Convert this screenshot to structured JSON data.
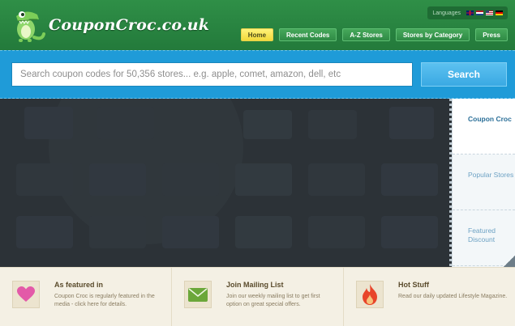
{
  "header": {
    "logo_text": "CouponCroc.co.uk",
    "languages_label": "Languages",
    "flags": [
      "uk-flag-icon",
      "nl-flag-icon",
      "us-flag-icon",
      "de-flag-icon"
    ]
  },
  "nav": {
    "items": [
      {
        "label": "Home",
        "active": true
      },
      {
        "label": "Recent Codes"
      },
      {
        "label": "A-Z Stores"
      },
      {
        "label": "Stores by Category"
      },
      {
        "label": "Press"
      }
    ]
  },
  "search": {
    "placeholder": "Search coupon codes for 50,356 stores... e.g. apple, comet, amazon, dell, etc",
    "button_label": "Search"
  },
  "tabs": [
    {
      "label": "Coupon Croc",
      "active": true
    },
    {
      "label": "Popular Stores"
    },
    {
      "label": "Featured Discount"
    }
  ],
  "features": [
    {
      "icon": "heart-icon",
      "title": "As featured in",
      "desc": "Coupon Croc is regularly featured in the media - click here for details."
    },
    {
      "icon": "envelope-icon",
      "title": "Join Mailing List",
      "desc": "Join our weekly mailing list to get first option on great special offers."
    },
    {
      "icon": "flame-icon",
      "title": "Hot Stuff",
      "desc": "Read our daily updated Lifestyle Magazine."
    }
  ],
  "colors": {
    "header_green": "#2f8f47",
    "search_blue": "#1f9bd8",
    "active_nav_yellow": "#f2d93a",
    "slider_dark": "#2c3237",
    "heart_pink": "#e35aa8",
    "envelope_green": "#6ba73a",
    "flame_red": "#e8452a"
  }
}
